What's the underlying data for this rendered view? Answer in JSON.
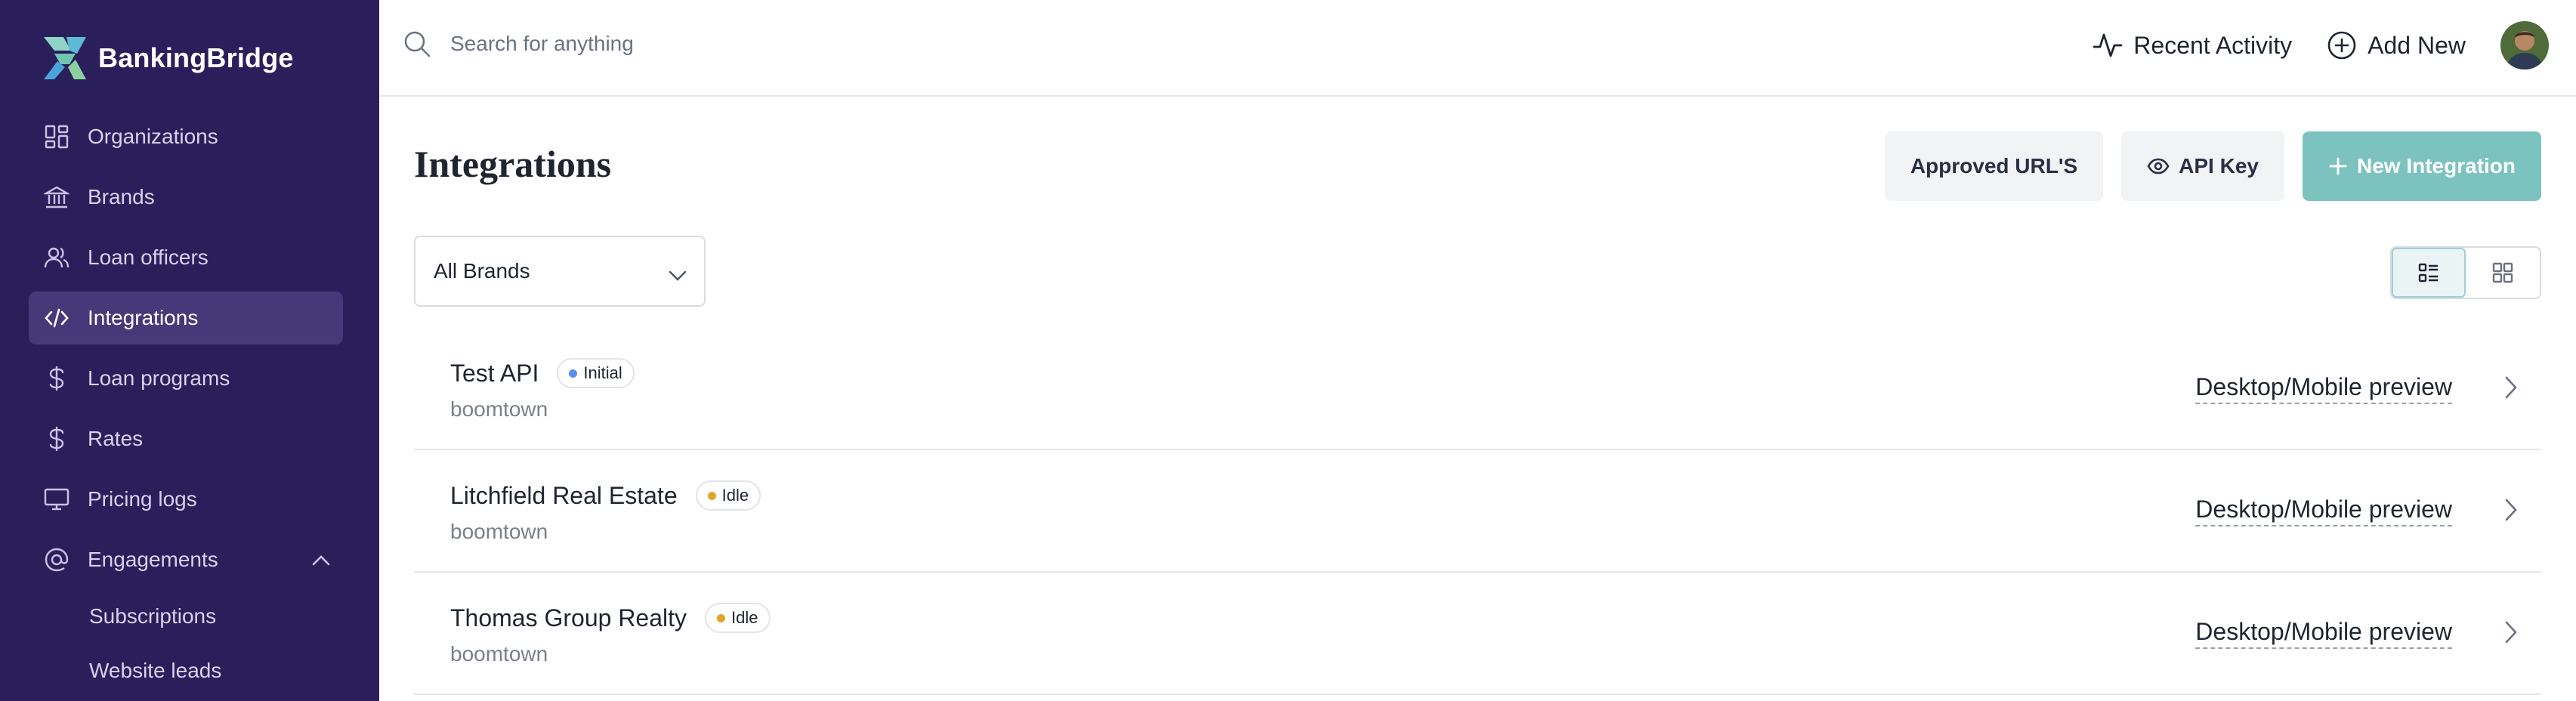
{
  "brand": {
    "name": "BankingBridge"
  },
  "sidebar": {
    "items": [
      {
        "label": "Organizations",
        "icon": "grid-icon"
      },
      {
        "label": "Brands",
        "icon": "bank-icon"
      },
      {
        "label": "Loan officers",
        "icon": "users-icon"
      },
      {
        "label": "Integrations",
        "icon": "code-icon",
        "active": true
      },
      {
        "label": "Loan programs",
        "icon": "dollar-icon"
      },
      {
        "label": "Rates",
        "icon": "dollar-icon"
      },
      {
        "label": "Pricing logs",
        "icon": "monitor-icon"
      },
      {
        "label": "Engagements",
        "icon": "at-icon",
        "expanded": true
      }
    ],
    "sub_items": [
      {
        "label": "Subscriptions"
      },
      {
        "label": "Website leads"
      }
    ]
  },
  "topbar": {
    "search_placeholder": "Search for anything",
    "recent_activity": "Recent Activity",
    "add_new": "Add New"
  },
  "page": {
    "title": "Integrations",
    "buttons": {
      "approved_urls": "Approved URL'S",
      "api_key": "API Key",
      "new_integration": "New Integration"
    },
    "brand_filter": "All Brands"
  },
  "integrations": [
    {
      "name": "Test API",
      "status": "Initial",
      "status_color": "#5b8def",
      "sub": "boomtown",
      "preview": "Desktop/Mobile preview"
    },
    {
      "name": "Litchfield Real Estate",
      "status": "Idle",
      "status_color": "#e0a526",
      "sub": "boomtown",
      "preview": "Desktop/Mobile preview"
    },
    {
      "name": "Thomas Group Realty",
      "status": "Idle",
      "status_color": "#e0a526",
      "sub": "boomtown",
      "preview": "Desktop/Mobile preview"
    }
  ],
  "colors": {
    "sidebar_bg": "#2b1f5b",
    "accent": "#7cc3c0"
  }
}
